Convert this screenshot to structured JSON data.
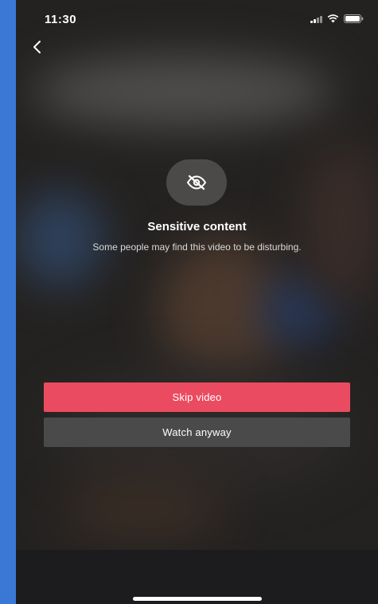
{
  "status_bar": {
    "time": "11:30"
  },
  "icons": {
    "back": "chevron-left-icon",
    "sensitive": "eye-off-icon",
    "signal": "signal-icon",
    "wifi": "wifi-icon",
    "battery": "battery-icon"
  },
  "warning": {
    "title": "Sensitive content",
    "description": "Some people may find this video to be disturbing."
  },
  "actions": {
    "skip_label": "Skip video",
    "watch_label": "Watch anyway"
  },
  "colors": {
    "skip_button": "#eb4b60",
    "watch_button": "#4a4a4a",
    "frame_background": "#3a78d6"
  }
}
